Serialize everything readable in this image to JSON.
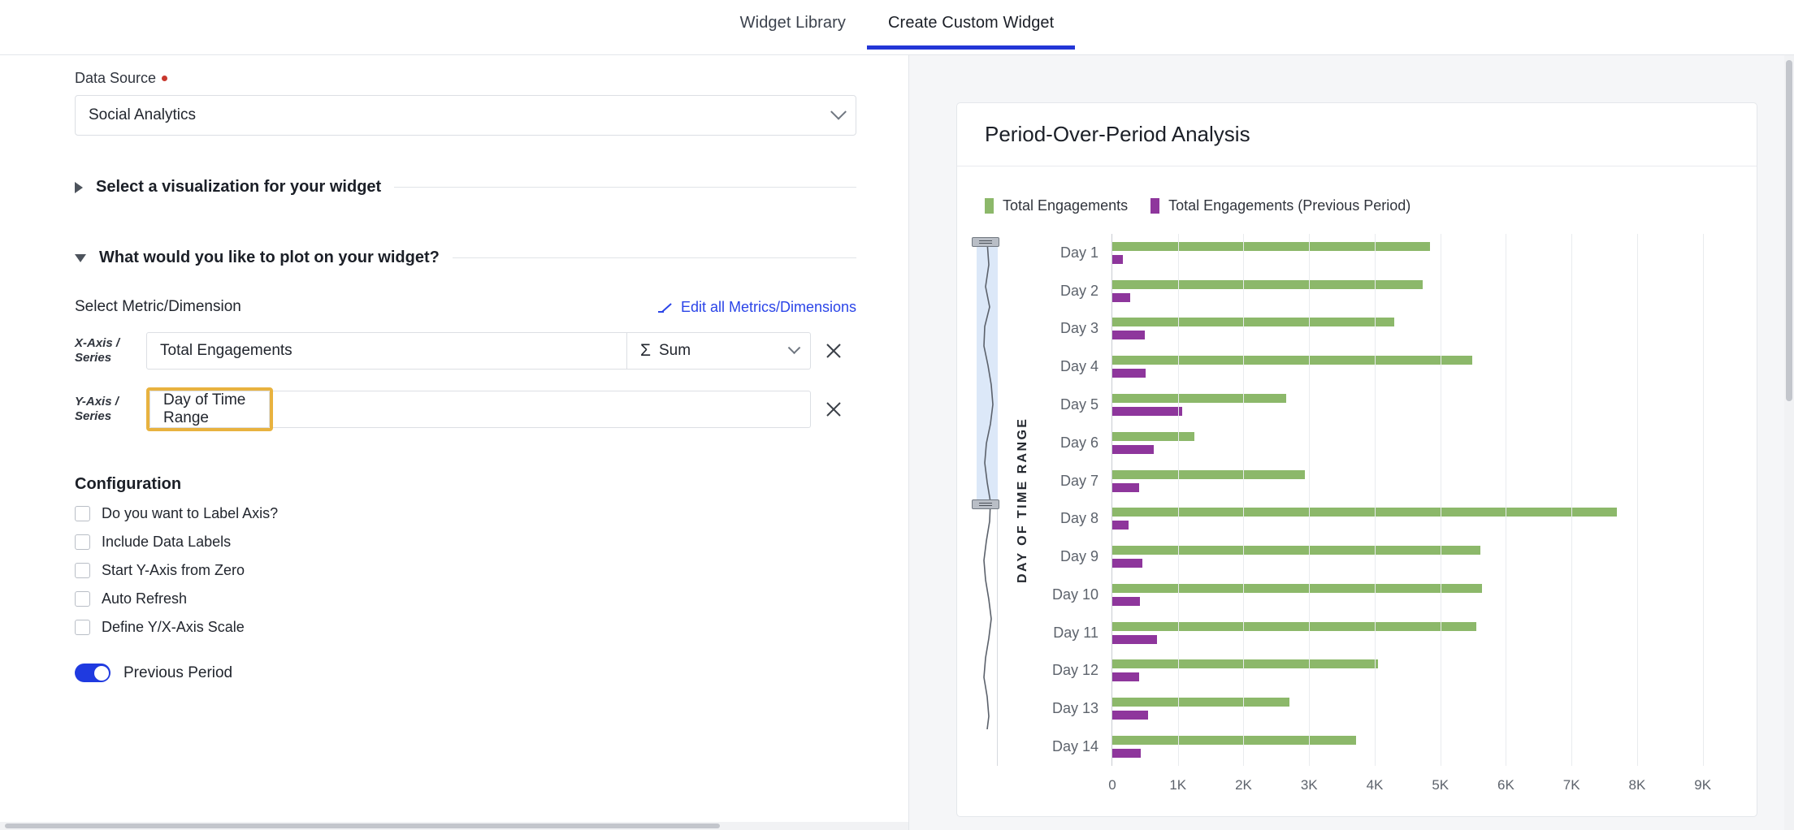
{
  "tabs": [
    {
      "label": "Widget Library",
      "active": false
    },
    {
      "label": "Create Custom Widget",
      "active": true
    }
  ],
  "form": {
    "data_source": {
      "label": "Data Source",
      "required_marker": "•",
      "value": "Social Analytics"
    },
    "sections": [
      {
        "title": "Select a visualization for your widget",
        "expanded": false
      },
      {
        "title": "What would you like to plot on your widget?",
        "expanded": true
      }
    ],
    "metric_dimension": {
      "heading": "Select Metric/Dimension",
      "edit_link": "Edit all Metrics/Dimensions",
      "x_axis": {
        "tag_line1": "X-Axis /",
        "tag_line2": "Series",
        "value": "Total Engagements",
        "aggregation": "Sum",
        "aggregation_symbol": "Σ",
        "remove": "×"
      },
      "y_axis": {
        "tag_line1": "Y-Axis /",
        "tag_line2": "Series",
        "value": "Day of Time Range",
        "remove": "×",
        "highlight_color": "#e8b23f"
      }
    },
    "configuration": {
      "heading": "Configuration",
      "checkboxes": [
        {
          "label": "Do you want to Label Axis?",
          "checked": false
        },
        {
          "label": "Include Data Labels",
          "checked": false
        },
        {
          "label": "Start Y-Axis from Zero",
          "checked": false
        },
        {
          "label": "Auto Refresh",
          "checked": false
        },
        {
          "label": "Define Y/X-Axis Scale",
          "checked": false
        }
      ],
      "toggle": {
        "label": "Previous Period",
        "on": true,
        "color": "#1f3ae0"
      }
    }
  },
  "preview": {
    "card_title": "Period-Over-Period Analysis"
  },
  "chart_data": {
    "type": "bar",
    "orientation": "horizontal",
    "title": "Period-Over-Period Analysis",
    "xlabel": "",
    "ylabel": "DAY OF TIME RANGE",
    "categories": [
      "Day 1",
      "Day 2",
      "Day 3",
      "Day 4",
      "Day 5",
      "Day 6",
      "Day 7",
      "Day 8",
      "Day 9",
      "Day 10",
      "Day 11",
      "Day 12",
      "Day 13",
      "Day 14"
    ],
    "series": [
      {
        "name": "Total Engagements",
        "color": "#8CB86A",
        "values": [
          4840,
          4730,
          4300,
          5490,
          2650,
          1250,
          2940,
          7690,
          5610,
          5630,
          5550,
          4050,
          2700,
          3710
        ]
      },
      {
        "name": "Total Engagements (Previous Period)",
        "color": "#8E369C",
        "values": [
          160,
          270,
          500,
          510,
          1070,
          630,
          410,
          250,
          460,
          420,
          680,
          410,
          540,
          430
        ]
      }
    ],
    "xlim": [
      0,
      9400
    ],
    "xticks": [
      0,
      1000,
      2000,
      3000,
      4000,
      5000,
      6000,
      7000,
      8000,
      9000
    ],
    "xticklabels": [
      "0",
      "1K",
      "2K",
      "3K",
      "4K",
      "5K",
      "6K",
      "7K",
      "8K",
      "9K"
    ],
    "grid": true,
    "legend_position": "top-left"
  }
}
